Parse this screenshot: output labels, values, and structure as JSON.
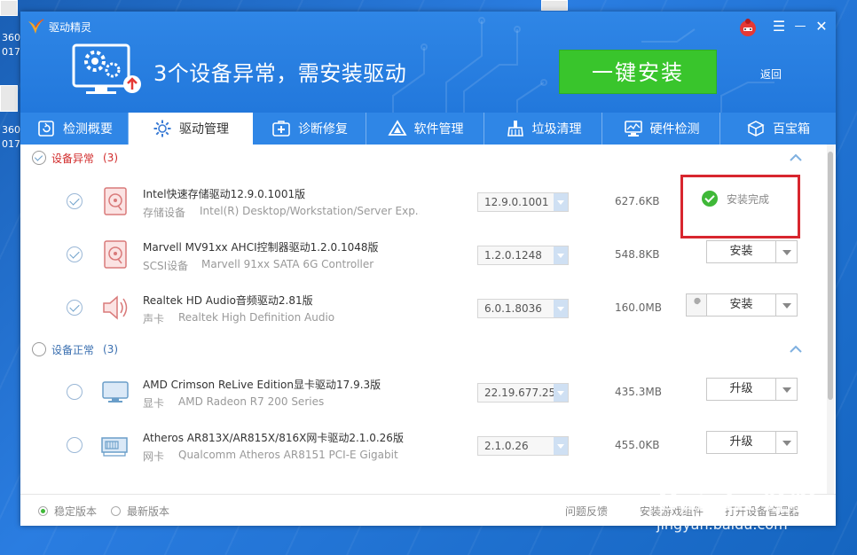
{
  "desktop": {
    "label_1": "360",
    "label_1b": "017",
    "label_2": "360",
    "label_2b": "017"
  },
  "app": {
    "title": "驱动精灵",
    "hero_text": "3个设备异常，需安装驱动",
    "install_all_label": "一键安装",
    "back_label": "返回",
    "controls": {
      "menu": "☰",
      "minimize": "—",
      "close": "✕"
    }
  },
  "tabs": [
    {
      "label": "检测概要",
      "icon": "refresh-icon"
    },
    {
      "label": "驱动管理",
      "icon": "gear-icon",
      "active": true
    },
    {
      "label": "诊断修复",
      "icon": "medkit-icon"
    },
    {
      "label": "软件管理",
      "icon": "triangle-icon"
    },
    {
      "label": "垃圾清理",
      "icon": "broom-icon"
    },
    {
      "label": "硬件检测",
      "icon": "monitor-icon"
    },
    {
      "label": "百宝箱",
      "icon": "box-icon"
    }
  ],
  "groups": {
    "abnormal": {
      "label": "设备异常",
      "count": "(3)"
    },
    "normal": {
      "label": "设备正常",
      "count": "(3)"
    }
  },
  "drivers": [
    {
      "name": "Intel快速存储驱动12.9.0.1001版",
      "type": "存储设备",
      "desc": "Intel(R) Desktop/Workstation/Server Exp...",
      "version": "12.9.0.1001",
      "size": "627.6KB",
      "action": "安装完成",
      "status": "done",
      "icon": "storage-icon",
      "checked": true
    },
    {
      "name": "Marvell MV91xx AHCI控制器驱动1.2.0.1048版",
      "type": "SCSI设备",
      "desc": "Marvell 91xx SATA 6G Controller",
      "version": "1.2.0.1248",
      "size": "548.8KB",
      "action": "安装",
      "status": "pending",
      "icon": "storage-icon",
      "checked": true
    },
    {
      "name": "Realtek HD Audio音频驱动2.81版",
      "type": "声卡",
      "desc": "Realtek High Definition Audio",
      "version": "6.0.1.8036",
      "size": "160.0MB",
      "action": "安装",
      "status": "pending",
      "icon": "speaker-icon",
      "checked": true
    },
    {
      "name": "AMD Crimson ReLive Edition显卡驱动17.9.3版",
      "type": "显卡",
      "desc": "AMD Radeon R7 200 Series",
      "version": "22.19.677.25",
      "size": "435.3MB",
      "action": "升级",
      "status": "pending",
      "icon": "display-icon",
      "checked": false
    },
    {
      "name": "Atheros AR813X/AR815X/816X网卡驱动2.1.0.26版",
      "type": "网卡",
      "desc": "Qualcomm Atheros AR8151 PCI-E Gigabit...",
      "version": "2.1.0.26",
      "size": "455.0KB",
      "action": "升级",
      "status": "pending",
      "icon": "network-card-icon",
      "checked": false
    }
  ],
  "footer": {
    "stable_label": "稳定版本",
    "latest_label": "最新版本",
    "feedback_label": "问题反馈",
    "game_component_label": "安装游戏组件",
    "device_manager_label": "打开设备管理器"
  },
  "watermark": {
    "brand": "Bai du 经验",
    "url": "jingyan.baidu.com"
  },
  "colors": {
    "brand_blue": "#2f86e6",
    "install_green": "#39c52c",
    "alert_red": "#d12b2b",
    "highlight_red": "#d8262e"
  }
}
